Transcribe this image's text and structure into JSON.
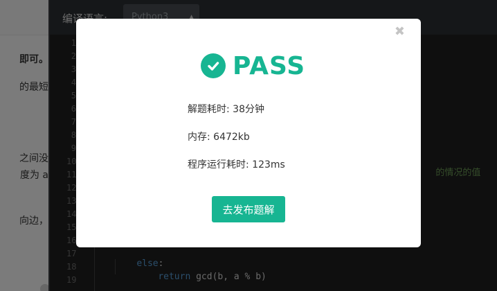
{
  "problem": {
    "snippets": [
      "即可。",
      "的最短",
      "之间没",
      "度为 a",
      "向边，"
    ]
  },
  "editor": {
    "language_label": "编译语言:",
    "language_value": "Python3",
    "line_numbers": [
      "1",
      "2",
      "3",
      "4",
      "5",
      "6",
      "7",
      "8",
      "9",
      "10",
      "11",
      "12",
      "13",
      "14",
      "15",
      "16",
      "17",
      "18",
      "19"
    ],
    "visible_comment": "的情况的值",
    "code": {
      "else_kw": "else",
      "else_colon": ":",
      "return_kw": "return",
      "return_expr": " gcd(b, a % b)"
    }
  },
  "modal": {
    "status": "PASS",
    "stats": [
      {
        "label": "解题耗时: ",
        "value": "38分钟"
      },
      {
        "label": "内存: ",
        "value": "6472kb"
      },
      {
        "label": "程序运行耗时: ",
        "value": "123ms"
      }
    ],
    "close_symbol": "✖",
    "publish_button": "去发布题解"
  },
  "colors": {
    "accent": "#17b592",
    "overlay": "rgba(0,0,0,0.5)",
    "editor_bg": "#1e1e1e"
  },
  "icons": {
    "status": "check-circle-icon",
    "close": "close-icon",
    "select": "caret-up-icon"
  }
}
